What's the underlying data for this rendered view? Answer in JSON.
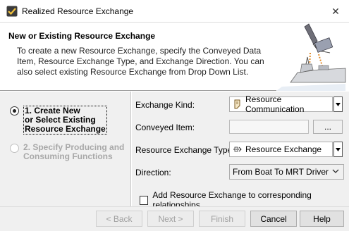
{
  "window": {
    "title": "Realized Resource Exchange",
    "close_glyph": "✕"
  },
  "header": {
    "title": "New or Existing Resource Exchange",
    "description": "To create a new Resource Exchange, specify the Conveyed Data Item, Resource Exchange Type, and Exchange Direction. You can also select existing Resource Exchange from Drop Down List."
  },
  "steps": [
    {
      "label": "1. Create New or Select Existing Resource Exchange",
      "line1": "1. Create New",
      "line2": "or Select Existing",
      "line3": "Resource Exchange",
      "selected": true
    },
    {
      "label": "2. Specify Producing and Consuming Functions",
      "line1": "2. Specify Producing and",
      "line2": "Consuming Functions",
      "selected": false
    }
  ],
  "form": {
    "exchange_kind": {
      "label": "Exchange Kind:",
      "value": "Resource Communication",
      "icon": "resource-communication-icon"
    },
    "conveyed_item": {
      "label": "Conveyed Item:",
      "value": "",
      "browse_label": "..."
    },
    "exchange_type": {
      "label": "Resource Exchange Type:",
      "value": "Resource Exchange",
      "icon": "resource-exchange-icon"
    },
    "direction": {
      "label": "Direction:",
      "value": "From Boat To MRT Driver"
    },
    "add_to_relationships": {
      "label": "Add Resource Exchange to corresponding relationships",
      "checked": false
    }
  },
  "buttons": {
    "back": "< Back",
    "next": "Next >",
    "finish": "Finish",
    "cancel": "Cancel",
    "help": "Help"
  },
  "colors": {
    "header_bg": "#ffffff",
    "panel_bg": "#f0f0f0",
    "disabled_text": "#a8a8a8"
  }
}
